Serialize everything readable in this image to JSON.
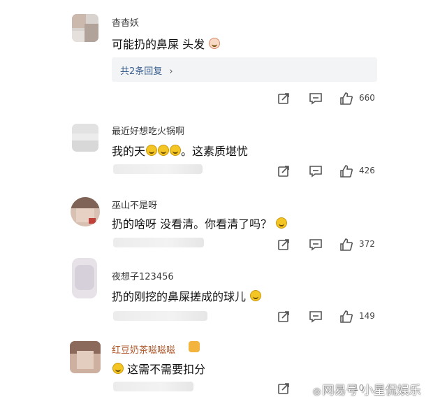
{
  "comments": [
    {
      "username": "杳杳妖",
      "text": "可能扔的鼻屎 头发",
      "reply_label": "共2条回复",
      "likes": "660",
      "avatar_colors": [
        "#d5cbc5",
        "#b7a79f",
        "#e7e2df"
      ]
    },
    {
      "username": "最近好想吃火锅啊",
      "text_before": "我的天",
      "text_after": "。这素质堪忧",
      "likes": "426",
      "avatar_colors": [
        "#e9e9e9",
        "#d9d9d9",
        "#f2f2f2"
      ]
    },
    {
      "username": "巫山不是呀",
      "text": "扔的啥呀 没看清。你看清了吗？",
      "likes": "372",
      "avatar_colors": [
        "#c9a28f",
        "#8c6f62",
        "#e4d3c8"
      ]
    },
    {
      "username": "夜想子123456",
      "text": "扔的刚挖的鼻屎搓成的球儿",
      "likes": "149",
      "avatar_colors": [
        "#e3e0e5",
        "#cfcbd3",
        "#f1f0f3"
      ]
    },
    {
      "username": "红豆奶茶嗞嗞嗞",
      "text": "这需不需要扣分",
      "likes": "10",
      "avatar_colors": [
        "#c7a591",
        "#9a7565",
        "#e2ccc0"
      ]
    }
  ],
  "watermark": {
    "icon": "wechat-icon",
    "text": "网易号 小星侃娱乐"
  },
  "colors": {
    "username_vip": "#b0572a",
    "reply_text": "#3a5f8f",
    "icon_stroke": "#555555"
  },
  "icons": [
    "share-icon",
    "comment-icon",
    "like-icon"
  ]
}
